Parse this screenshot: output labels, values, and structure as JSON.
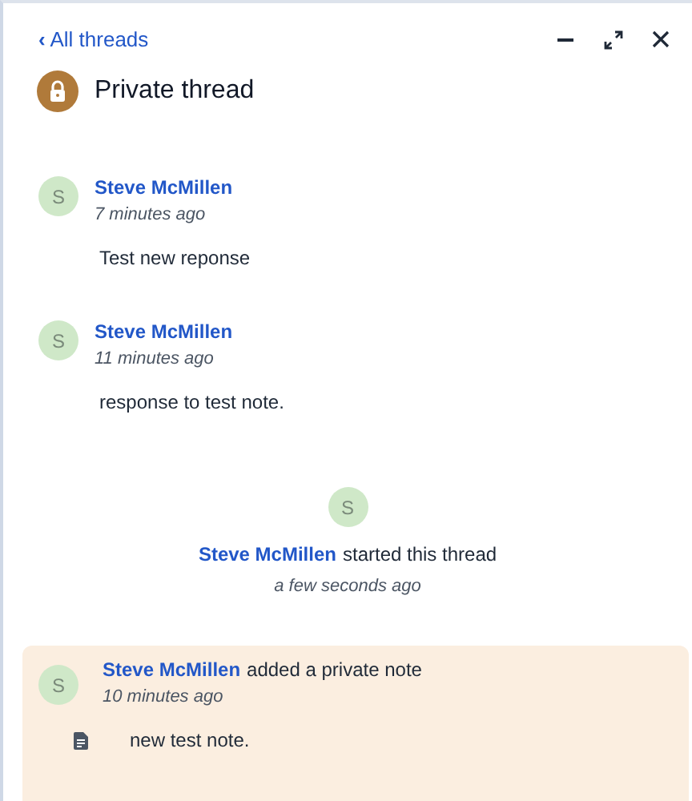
{
  "header": {
    "back_link": "All threads",
    "back_glyph": "‹",
    "title": "Private thread"
  },
  "events": [
    {
      "kind": "message",
      "initial": "S",
      "author": "Steve McMillen",
      "time": "7 minutes ago",
      "body": "Test new reponse"
    },
    {
      "kind": "message",
      "initial": "S",
      "author": "Steve McMillen",
      "time": "11 minutes ago",
      "body": "response to test note."
    },
    {
      "kind": "started",
      "initial": "S",
      "author": "Steve McMillen",
      "action": "started this thread",
      "time": "a few seconds ago"
    },
    {
      "kind": "note",
      "initial": "S",
      "author": "Steve McMillen",
      "action": "added a private note",
      "time": "10 minutes ago",
      "body": "new test note."
    }
  ]
}
